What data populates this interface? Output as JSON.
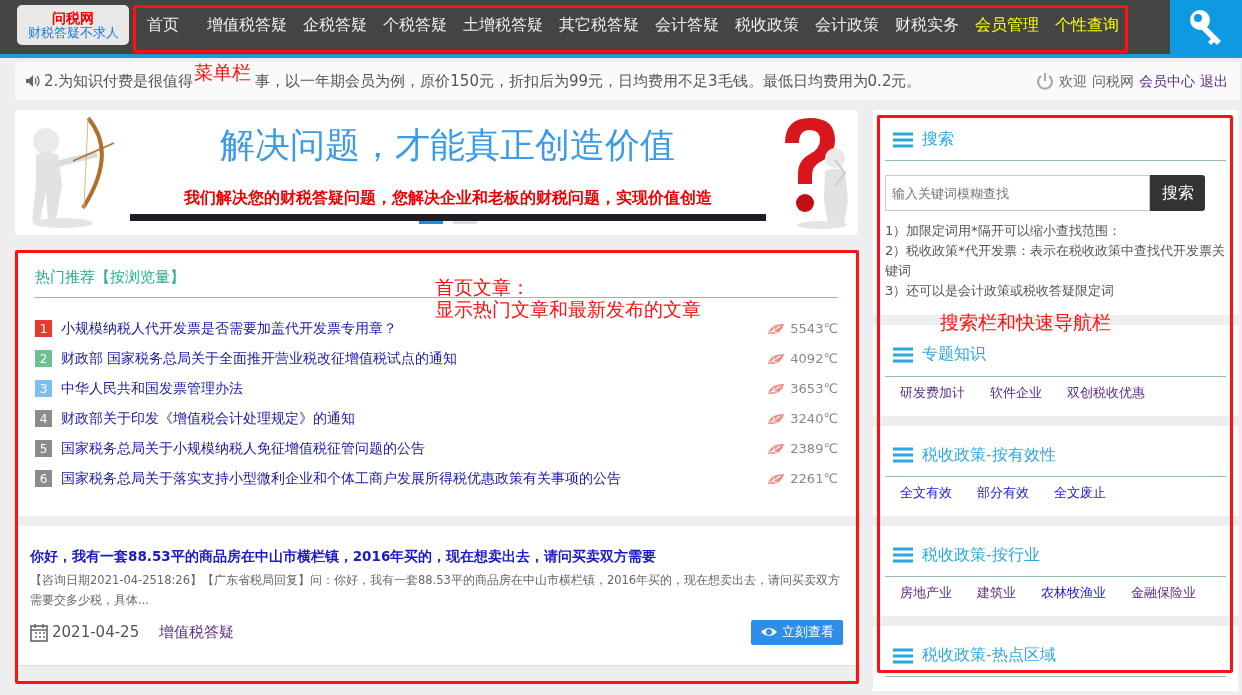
{
  "header": {
    "logo": {
      "title": "问税网",
      "slogan": "财税答疑不求人"
    },
    "menu": [
      {
        "label": "首页",
        "highlighted": false
      },
      {
        "label": "增值税答疑",
        "highlighted": false
      },
      {
        "label": "企税答疑",
        "highlighted": false
      },
      {
        "label": "个税答疑",
        "highlighted": false
      },
      {
        "label": "土增税答疑",
        "highlighted": false
      },
      {
        "label": "其它税答疑",
        "highlighted": false
      },
      {
        "label": "会计答疑",
        "highlighted": false
      },
      {
        "label": "税收政策",
        "highlighted": false
      },
      {
        "label": "会计政策",
        "highlighted": false
      },
      {
        "label": "财税实务",
        "highlighted": false
      },
      {
        "label": "会员管理",
        "highlighted": true
      },
      {
        "label": "个性查询",
        "highlighted": true
      }
    ]
  },
  "notice": {
    "text_before": "2.为知识付费是很值得",
    "text_after": "事，以一年期会员为例，原价150元，折扣后为99元，日均费用不足3毛钱。最低日均费用为0.2元。",
    "welcome": "欢迎",
    "username": "问税网",
    "member_center": "会员中心",
    "logout": "退出"
  },
  "banner": {
    "title": "解决问题，才能真正创造价值",
    "subtitle": "我们解决您的财税答疑问题，您解决企业和老板的财税问题，实现价值创造",
    "indicators": [
      {
        "selected": true
      },
      {
        "selected": false
      }
    ]
  },
  "hot": {
    "title": "热门推荐【按浏览量】",
    "items": [
      {
        "rank": "1",
        "color": "#e8392e",
        "title": "小规模纳税人代开发票是否需要加盖代开发票专用章？",
        "heat": "5543℃"
      },
      {
        "rank": "2",
        "color": "#6cc291",
        "title": "财政部 国家税务总局关于全面推开营业税改征增值税试点的通知",
        "heat": "4092℃"
      },
      {
        "rank": "3",
        "color": "#7ebfef",
        "title": "中华人民共和国发票管理办法",
        "heat": "3653℃"
      },
      {
        "rank": "4",
        "color": "#8c8c8c",
        "title": "财政部关于印发《增值税会计处理规定》的通知",
        "heat": "3240℃"
      },
      {
        "rank": "5",
        "color": "#8c8c8c",
        "title": "国家税务总局关于小规模纳税人免征增值税征管问题的公告",
        "heat": "2389℃"
      },
      {
        "rank": "6",
        "color": "#8c8c8c",
        "title": "国家税务总局关于落实支持小型微利企业和个体工商户发展所得税优惠政策有关事项的公告",
        "heat": "2261℃"
      }
    ]
  },
  "article": {
    "title": "你好，我有一套88.53平的商品房在中山市横栏镇，2016年买的，现在想卖出去，请问买卖双方需要",
    "excerpt": "【咨询日期2021-04-2518:26】【广东省税局回复】问：你好，我有一套88.53平的商品房在中山市横栏镇，2016年买的，现在想卖出去，请问买卖双方需要交多少税，具体...",
    "date": "2021-04-25",
    "category": "增值税答疑",
    "button": "立刻查看"
  },
  "sidebar": {
    "search": {
      "title": "搜索",
      "placeholder": "输入关键词模糊查找",
      "button": "搜索",
      "tips": [
        "1）加限定词用*隔开可以缩小查找范围：",
        "2）税收政策*代开发票：表示在税收政策中查找代开发票关键词",
        "3）还可以是会计政策或税收答疑限定词"
      ]
    },
    "sections": [
      {
        "title": "专题知识",
        "links": [
          {
            "label": "研发费加计",
            "visited": true
          },
          {
            "label": "软件企业",
            "visited": true
          },
          {
            "label": "双创税收优惠",
            "visited": true
          }
        ]
      },
      {
        "title": "税收政策-按有效性",
        "links": [
          {
            "label": "全文有效",
            "visited": false
          },
          {
            "label": "部分有效",
            "visited": false
          },
          {
            "label": "全文废止",
            "visited": false
          }
        ]
      },
      {
        "title": "税收政策-按行业",
        "links": [
          {
            "label": "房地产业",
            "visited": true
          },
          {
            "label": "建筑业",
            "visited": true
          },
          {
            "label": "农林牧渔业",
            "visited": false
          },
          {
            "label": "金融保险业",
            "visited": true
          }
        ]
      },
      {
        "title": "税收政策-热点区域"
      }
    ]
  },
  "annotations": [
    {
      "lines": [
        "菜单栏"
      ]
    },
    {
      "lines": [
        "首页文章：",
        "显示热门文章和最新发布的文章"
      ]
    },
    {
      "lines": [
        "搜索栏和快速导航栏"
      ]
    }
  ]
}
